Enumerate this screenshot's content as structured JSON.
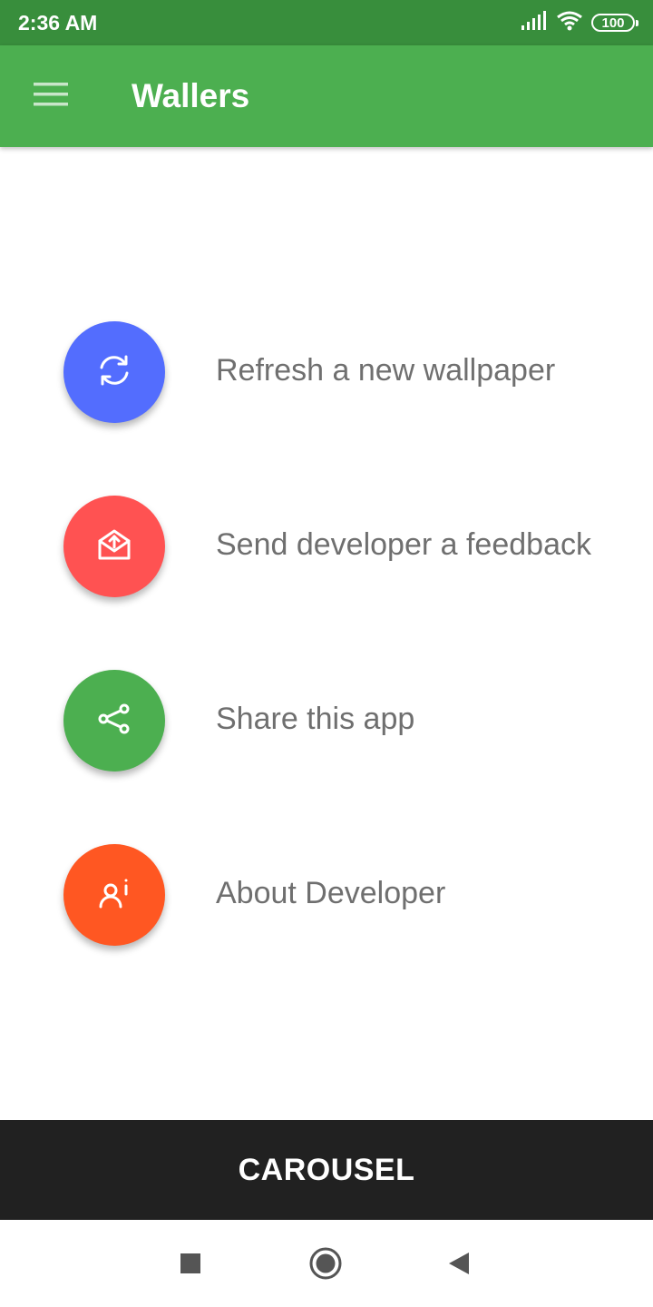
{
  "status_bar": {
    "time": "2:36 AM",
    "battery": "100",
    "icons": [
      "signal-icon",
      "wifi-icon",
      "battery-icon"
    ]
  },
  "app_bar": {
    "title": "Wallers",
    "menu_icon": "hamburger-menu-icon",
    "background": "#4caf50"
  },
  "actions": [
    {
      "label": "Refresh a new wallpaper",
      "icon": "refresh-icon",
      "color": "#536dfe"
    },
    {
      "label": "Send developer a feedback",
      "icon": "mail-send-icon",
      "color": "#ff5252"
    },
    {
      "label": "Share this app",
      "icon": "share-icon",
      "color": "#4caf50"
    },
    {
      "label": "About Developer",
      "icon": "person-info-icon",
      "color": "#ff5722"
    }
  ],
  "bottom_button": {
    "label": "CAROUSEL",
    "background": "#212121"
  },
  "nav_bar": {
    "icons": [
      "recents-square-icon",
      "home-circle-icon",
      "back-triangle-icon"
    ]
  }
}
